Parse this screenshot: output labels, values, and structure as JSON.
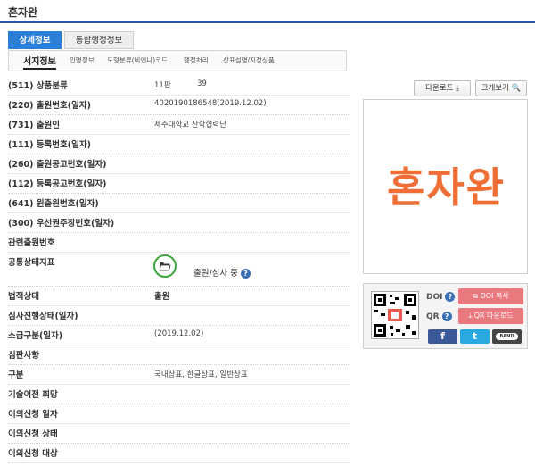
{
  "page": {
    "title": "혼자완"
  },
  "tabs": [
    {
      "label": "상세정보",
      "active": true
    },
    {
      "label": "통합행정정보",
      "active": false
    }
  ],
  "subtabs": [
    "서지정보",
    "인명정보",
    "도형분류(비엔나)코드",
    "행정처리",
    "상표설명/지정상품"
  ],
  "fields": [
    {
      "label": "(511) 상품분류",
      "value": "11판",
      "value2": "39"
    },
    {
      "label": "(220) 출원번호(일자)",
      "value": "4020190186548(2019.12.02)"
    },
    {
      "label": "(731) 출원인",
      "value": "제주대학교 산학협력단"
    },
    {
      "label": "(111) 등록번호(일자)",
      "value": ""
    },
    {
      "label": "(260) 출원공고번호(일자)",
      "value": ""
    },
    {
      "label": "(112) 등록공고번호(일자)",
      "value": ""
    },
    {
      "label": "(641) 원출원번호(일자)",
      "value": ""
    },
    {
      "label": "(300) 우선권주장번호(일자)",
      "value": ""
    },
    {
      "label": "관련출원번호",
      "value": ""
    },
    {
      "label": "공통상태지표",
      "value": ""
    },
    {
      "label": "법적상태",
      "value": "출원"
    },
    {
      "label": "심사진행상태(일자)",
      "value": ""
    },
    {
      "label": "소급구분(일자)",
      "value": "(2019.12.02)"
    },
    {
      "label": "심판사항",
      "value": ""
    },
    {
      "label": "구분",
      "value": "국내상표, 한글상표, 일반상표"
    },
    {
      "label": "기술이전 희망",
      "value": ""
    },
    {
      "label": "이의신청 일자",
      "value": ""
    },
    {
      "label": "이의신청 상태",
      "value": ""
    },
    {
      "label": "이의신청 대상",
      "value": ""
    }
  ],
  "status": {
    "text": "출원/심사 중",
    "help": "?"
  },
  "buttons": {
    "download": "다운로드 ⤓",
    "zoom": "크게보기 🔍"
  },
  "trademark_text": "혼자완",
  "share_panel": {
    "doi_label": "DOI",
    "qr_label": "QR",
    "help": "?",
    "doi_copy": "DOI 복사",
    "qr_download": "QR 다운로드",
    "facebook": "f",
    "twitter": "t",
    "band": "BAND"
  },
  "colors": {
    "accent": "#2c7fd6",
    "mark": "#ef6e35",
    "pink": "#e9787f",
    "facebook": "#3b5998",
    "twitter": "#2aa9e0"
  }
}
